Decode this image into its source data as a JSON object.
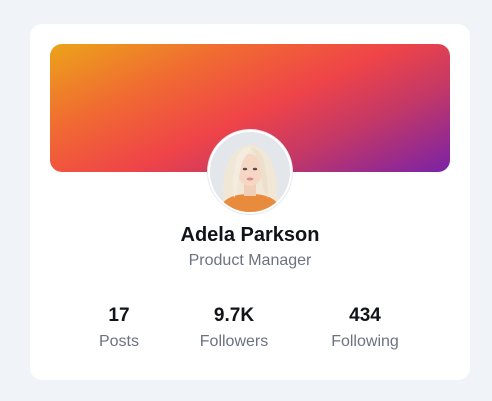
{
  "profile": {
    "name": "Adela Parkson",
    "role": "Product Manager"
  },
  "stats": [
    {
      "value": "17",
      "label": "Posts"
    },
    {
      "value": "9.7K",
      "label": "Followers"
    },
    {
      "value": "434",
      "label": "Following"
    }
  ],
  "colors": {
    "cover_gradient": [
      "#eca31a",
      "#f06a32",
      "#ef4448",
      "#c43866",
      "#7a22a7"
    ],
    "page_background": "#f0f3f7",
    "card_background": "#ffffff",
    "name_text": "#111318",
    "muted_text": "#6b7280"
  }
}
